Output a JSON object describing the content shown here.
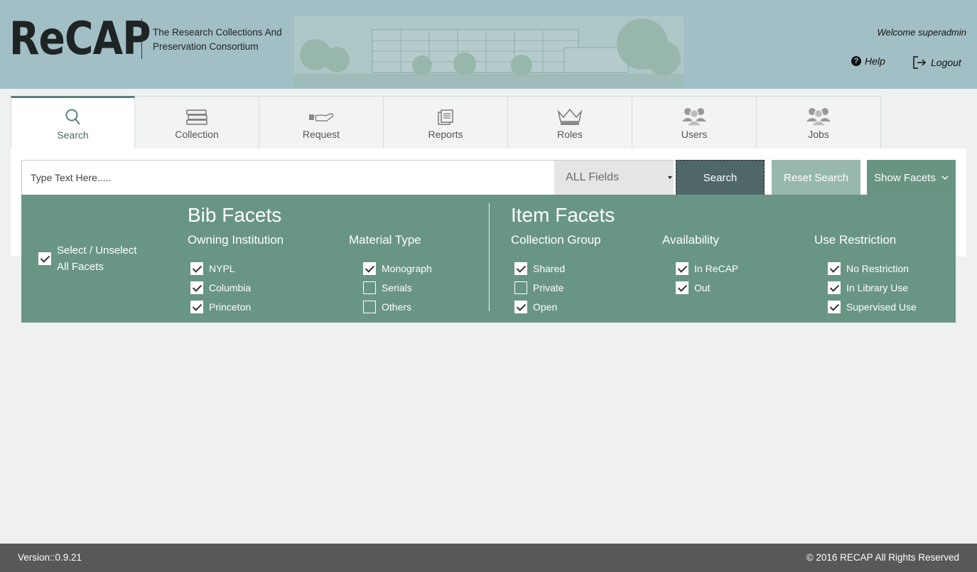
{
  "header": {
    "logo": "ReCAP",
    "tagline": "The Research Collections And Preservation Consortium",
    "welcome": "Welcome superadmin",
    "help_label": "Help",
    "logout_label": "Logout"
  },
  "tabs": [
    {
      "label": "Search",
      "icon": "search-icon",
      "active": true
    },
    {
      "label": "Collection",
      "icon": "books-icon"
    },
    {
      "label": "Request",
      "icon": "hand-book-icon"
    },
    {
      "label": "Reports",
      "icon": "documents-icon"
    },
    {
      "label": "Roles",
      "icon": "crown-icon"
    },
    {
      "label": "Users",
      "icon": "users-icon"
    },
    {
      "label": "Jobs",
      "icon": "users-icon"
    }
  ],
  "search": {
    "placeholder": "Type Text Here.....",
    "field_value": "ALL Fields",
    "search_label": "Search",
    "reset_label": "Reset Search",
    "facets_label": "Show Facets"
  },
  "facets": {
    "select_all_label": "Select / Unselect All Facets",
    "select_all_checked": true,
    "bib_title": "Bib Facets",
    "item_title": "Item Facets",
    "owning_institution": {
      "title": "Owning Institution",
      "options": [
        {
          "label": "NYPL",
          "checked": true
        },
        {
          "label": "Columbia",
          "checked": true
        },
        {
          "label": "Princeton",
          "checked": true
        }
      ]
    },
    "material_type": {
      "title": "Material Type",
      "options": [
        {
          "label": "Monograph",
          "checked": true
        },
        {
          "label": "Serials",
          "checked": false
        },
        {
          "label": "Others",
          "checked": false
        }
      ]
    },
    "collection_group": {
      "title": "Collection Group",
      "options": [
        {
          "label": "Shared",
          "checked": true
        },
        {
          "label": "Private",
          "checked": false
        },
        {
          "label": "Open",
          "checked": true
        }
      ]
    },
    "availability": {
      "title": "Availability",
      "options": [
        {
          "label": "In ReCAP",
          "checked": true
        },
        {
          "label": "Out",
          "checked": true
        }
      ]
    },
    "use_restriction": {
      "title": "Use Restriction",
      "options": [
        {
          "label": "No Restriction",
          "checked": true
        },
        {
          "label": "In Library Use",
          "checked": true
        },
        {
          "label": "Supervised Use",
          "checked": true
        }
      ]
    }
  },
  "footer": {
    "version": "Version::0.9.21",
    "copyright": "© 2016 RECAP All Rights Reserved"
  },
  "colors": {
    "header_bg": "#a2bfc6",
    "facets_bg": "#699584",
    "search_btn": "#4f6769",
    "reset_btn": "#98b8ab",
    "footer_bg": "#58585a"
  }
}
